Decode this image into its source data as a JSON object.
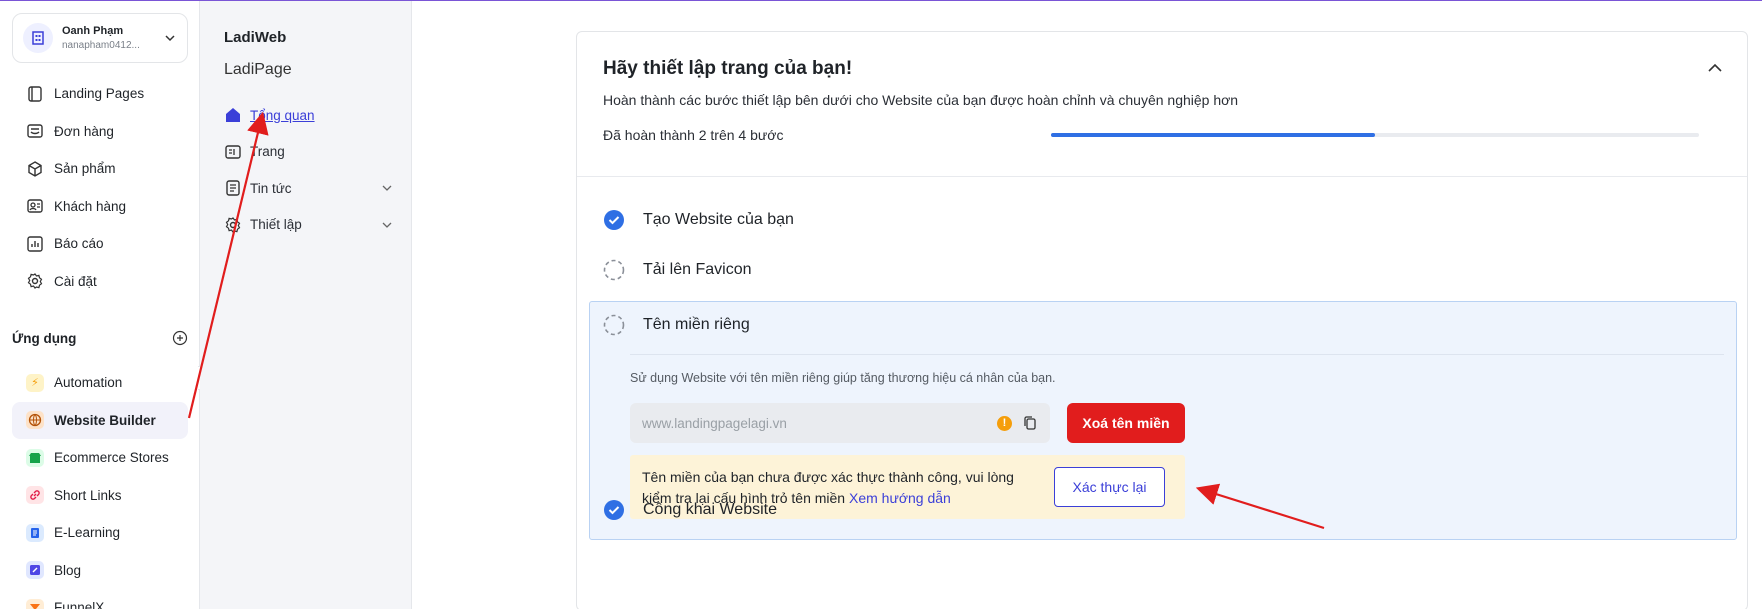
{
  "account": {
    "name": "Oanh Phạm",
    "email": "nanapham0412..."
  },
  "nav": [
    {
      "label": "Landing Pages",
      "icon": "landing-pages-icon"
    },
    {
      "label": "Đơn hàng",
      "icon": "orders-icon"
    },
    {
      "label": "Sản phẩm",
      "icon": "products-icon"
    },
    {
      "label": "Khách hàng",
      "icon": "customers-icon"
    },
    {
      "label": "Báo cáo",
      "icon": "reports-icon"
    },
    {
      "label": "Cài đặt",
      "icon": "settings-icon"
    }
  ],
  "apps": {
    "heading": "Ứng dụng",
    "items": [
      {
        "label": "Automation",
        "icon": "automation-icon",
        "color": "#f59e0b"
      },
      {
        "label": "Website Builder",
        "icon": "website-builder-icon",
        "color": "#b45309",
        "active": true
      },
      {
        "label": "Ecommerce Stores",
        "icon": "ecommerce-icon",
        "color": "#16a34a"
      },
      {
        "label": "Short Links",
        "icon": "short-links-icon",
        "color": "#e11d48"
      },
      {
        "label": "E-Learning",
        "icon": "e-learning-icon",
        "color": "#2563eb"
      },
      {
        "label": "Blog",
        "icon": "blog-icon",
        "color": "#4f46e5"
      },
      {
        "label": "FunnelX",
        "icon": "funnelx-icon",
        "color": "#f97316"
      }
    ]
  },
  "site": {
    "brand": "LadiWeb",
    "name": "LadiPage",
    "menu": [
      {
        "label": "Tổng quan",
        "active": true
      },
      {
        "label": "Trang"
      },
      {
        "label": "Tin tức"
      },
      {
        "label": "Thiết lập"
      }
    ]
  },
  "setup": {
    "title": "Hãy thiết lập trang của bạn!",
    "description": "Hoàn thành các bước thiết lập bên dưới cho Website của bạn được hoàn chỉnh và chuyên nghiệp hơn",
    "progress_text": "Đã hoàn thành 2 trên 4 bước",
    "progress_fraction": 0.5,
    "steps": [
      {
        "label": "Tạo Website của bạn",
        "done": true
      },
      {
        "label": "Tải lên Favicon",
        "done": false
      },
      {
        "label": "Tên miền riêng",
        "done": false
      },
      {
        "label": "Công khai Website",
        "done": true
      }
    ],
    "domain": {
      "hint": "Sử dụng Website với tên miền riêng giúp tăng thương hiệu cá nhân của bạn.",
      "value": "www.landingpagelagi.vn",
      "delete_label": "Xoá tên miền",
      "notice_text": "Tên miền của bạn chưa được xác thực thành công, vui lòng kiểm tra lại cấu hình trỏ tên miền ",
      "notice_link": "Xem hướng dẫn",
      "verify_label": "Xác thực lại"
    }
  },
  "colors": {
    "accent": "#3b3fd8",
    "progress": "#2f6fe4",
    "danger": "#e11d1d",
    "annotation": "#e11d1d"
  }
}
